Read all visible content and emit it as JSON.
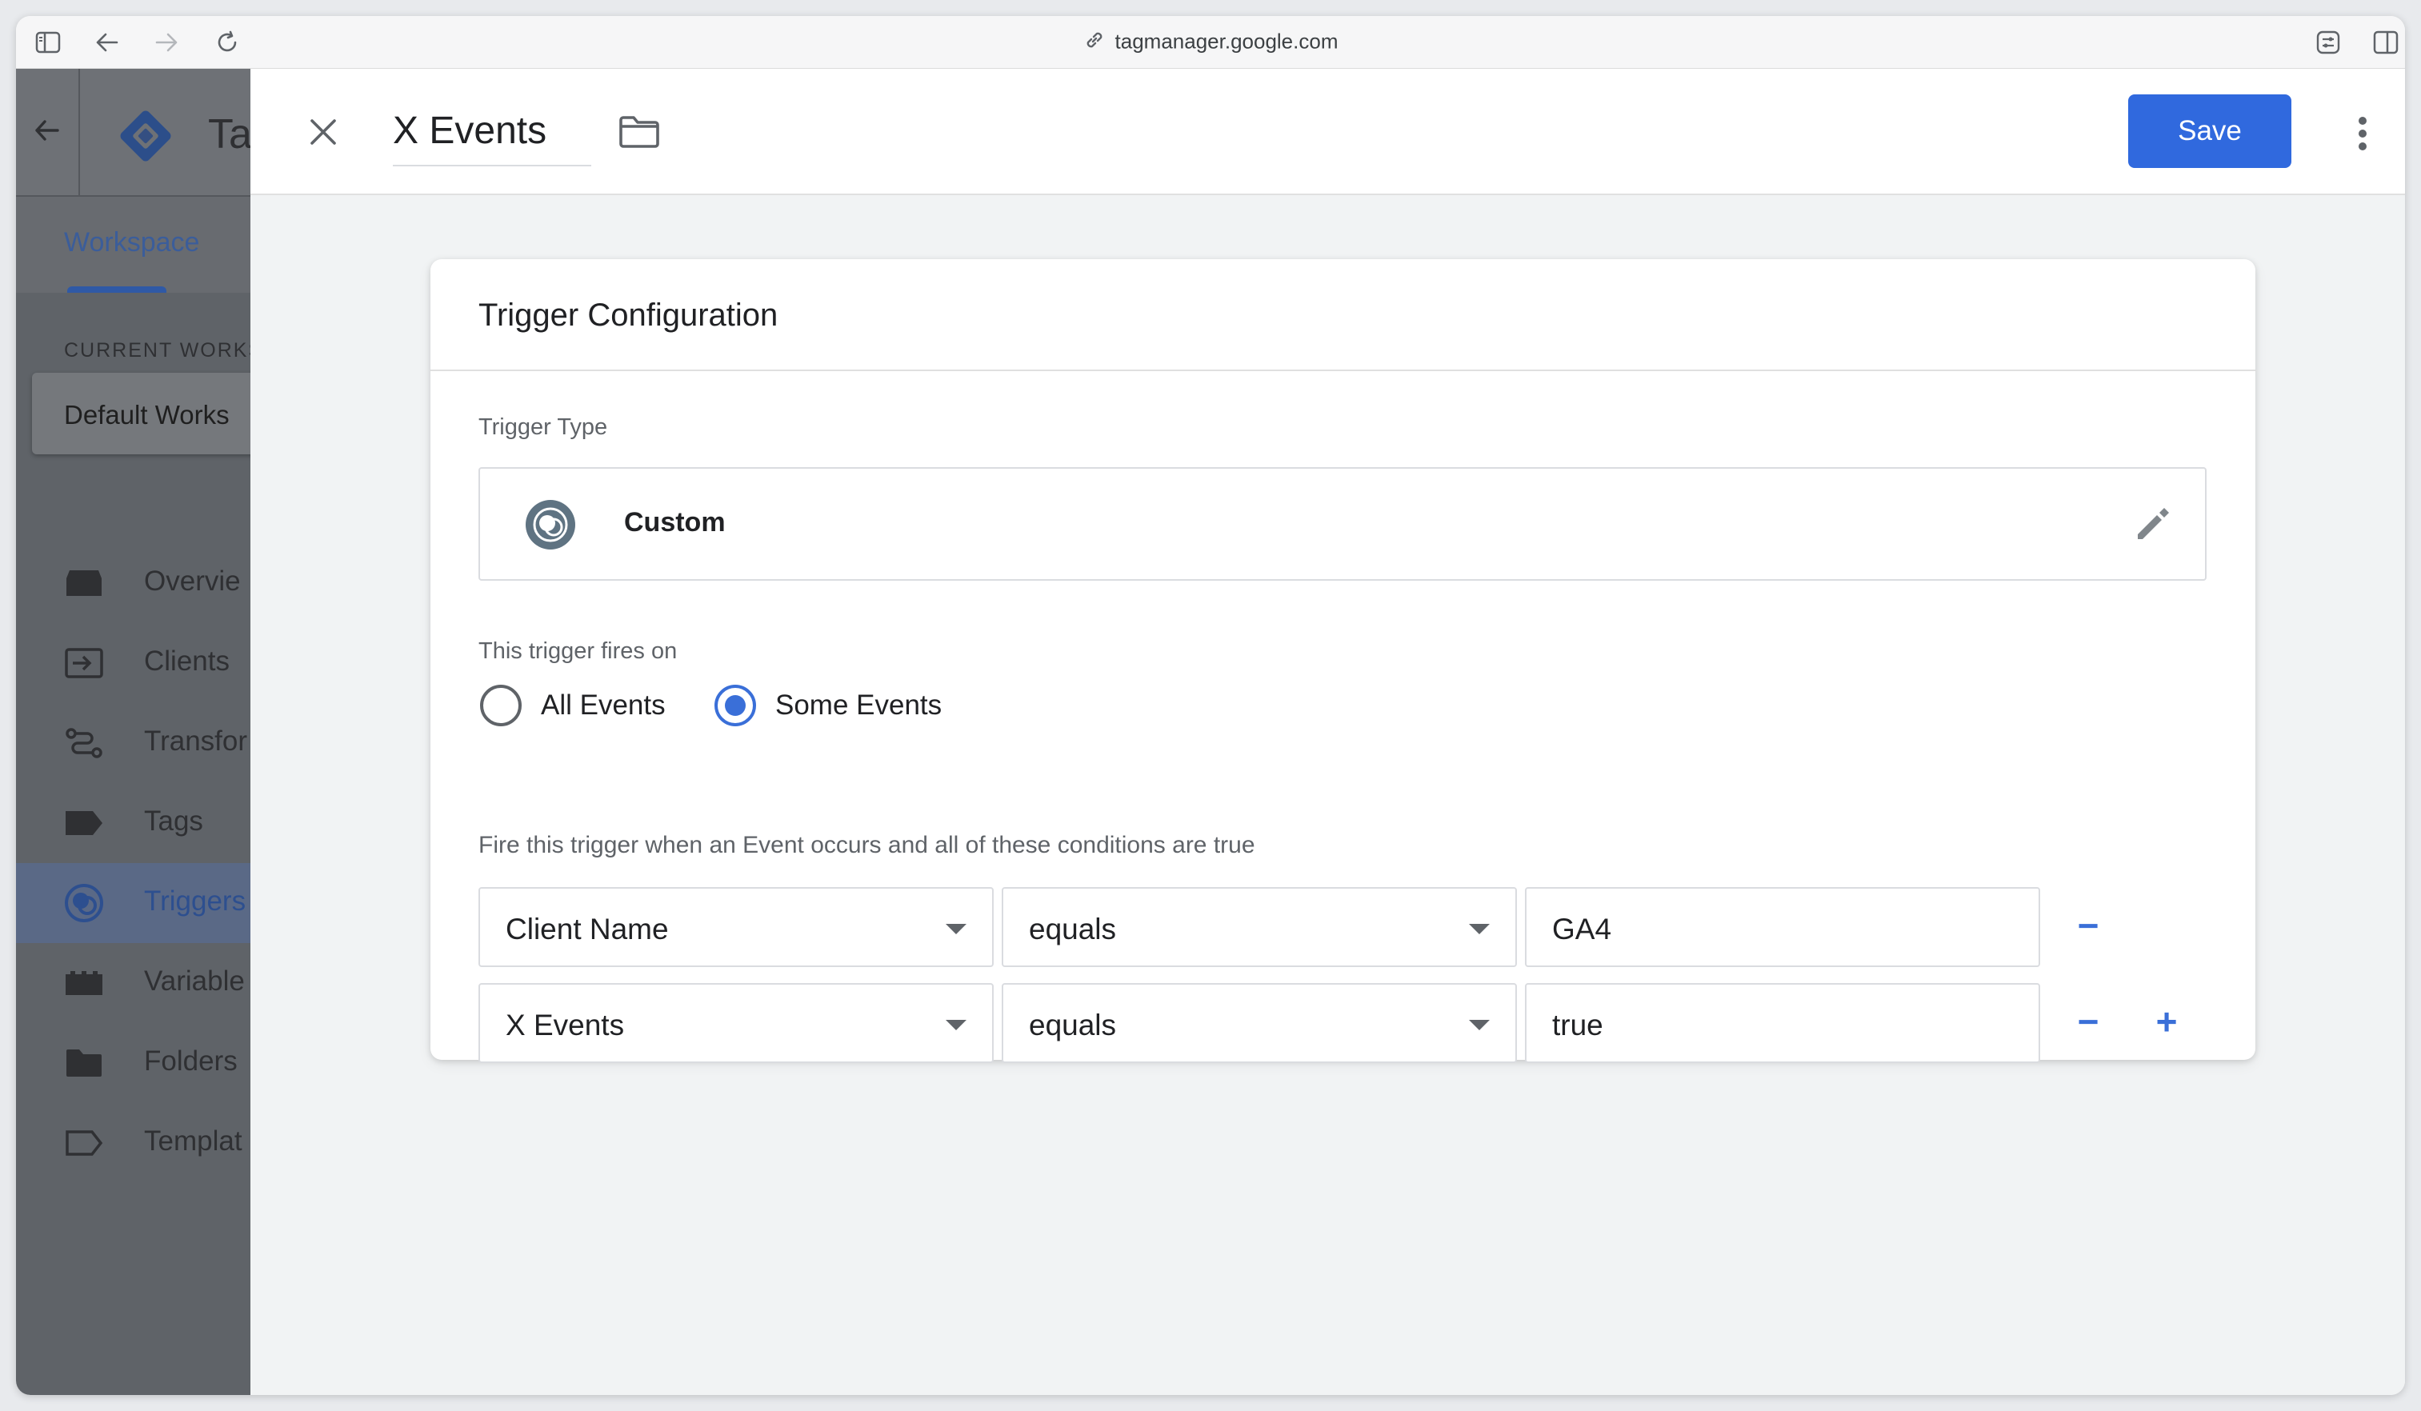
{
  "browser": {
    "url": "tagmanager.google.com",
    "icons": [
      "sidebar-toggle-icon",
      "back-arrow-icon",
      "forward-arrow-icon",
      "reload-icon",
      "link-icon",
      "extensions-icon",
      "split-view-icon"
    ]
  },
  "sidebar": {
    "app_title": "Ta",
    "workspace_tab": "Workspace",
    "current_workspace_label": "CURRENT WORKS",
    "workspace_name": "Default Works",
    "nav": [
      {
        "label": "Overvie",
        "icon": "overview-icon"
      },
      {
        "label": "Clients",
        "icon": "clients-icon"
      },
      {
        "label": "Transfor",
        "icon": "transformations-icon"
      },
      {
        "label": "Tags",
        "icon": "tag-icon"
      },
      {
        "label": "Triggers",
        "icon": "triggers-icon",
        "active": true
      },
      {
        "label": "Variable",
        "icon": "variables-icon"
      },
      {
        "label": "Folders",
        "icon": "folder-icon"
      },
      {
        "label": "Templat",
        "icon": "templates-icon"
      }
    ]
  },
  "header": {
    "name": "X Events",
    "save_label": "Save"
  },
  "trigger_config": {
    "title": "Trigger Configuration",
    "type_label": "Trigger Type",
    "type_name": "Custom",
    "fires_on_label": "This trigger fires on",
    "options": [
      "All Events",
      "Some Events"
    ],
    "selected_option": "Some Events",
    "conditions_label": "Fire this trigger when an Event occurs and all of these conditions are true",
    "conditions": [
      {
        "variable": "Client Name",
        "operator": "equals",
        "value": "GA4"
      },
      {
        "variable": "X Events",
        "operator": "equals",
        "value": "true"
      }
    ],
    "remove_symbol": "−",
    "add_symbol": "+"
  },
  "colors": {
    "accent": "#3069de",
    "overlay_sidebar": "#5f6368",
    "active_nav": "#5a6986"
  }
}
